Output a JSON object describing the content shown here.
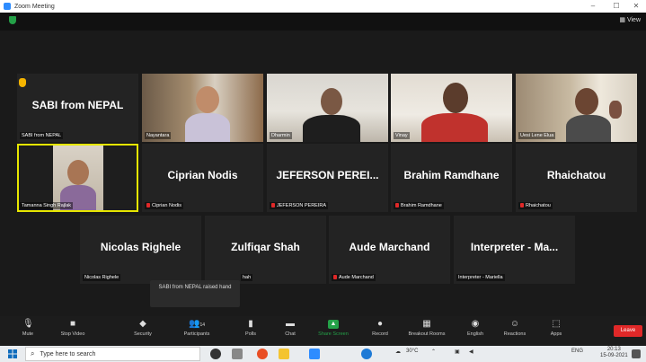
{
  "window": {
    "title": "Zoom Meeting",
    "controls": [
      "–",
      "☐",
      "✕"
    ]
  },
  "topbar": {
    "view_label": "View"
  },
  "tiles": [
    {
      "big_name": "SABI from NEPAL",
      "label": "SABI from NEPAL",
      "video": false,
      "muted": false,
      "hand_raised": true
    },
    {
      "big_name": "",
      "label": "Nayantara",
      "video": true,
      "muted": false
    },
    {
      "big_name": "",
      "label": "Dharmin",
      "video": true,
      "muted": false
    },
    {
      "big_name": "",
      "label": "Vinay",
      "video": true,
      "muted": false
    },
    {
      "big_name": "",
      "label": "Uesi Lene Elua",
      "video": true,
      "muted": false
    },
    {
      "big_name": "",
      "label": "Tamanna Singh Rajlak",
      "video": true,
      "muted": false,
      "active": true
    },
    {
      "big_name": "Ciprian Nodis",
      "label": "Ciprian Nodis",
      "video": false,
      "muted": true
    },
    {
      "big_name": "JEFERSON PEREI...",
      "label": "JEFERSON PEREIRA",
      "video": false,
      "muted": true
    },
    {
      "big_name": "Brahim Ramdhane",
      "label": "Brahim Ramdhane",
      "video": false,
      "muted": true
    },
    {
      "big_name": "Rhaichatou",
      "label": "Rhaichatou",
      "video": false,
      "muted": true
    },
    {
      "big_name": "Nicolas Righele",
      "label": "Nicolas Righele",
      "video": false,
      "muted": false
    },
    {
      "big_name": "Zulfiqar Shah",
      "label": "hah",
      "video": false,
      "muted": false
    },
    {
      "big_name": "Aude Marchand",
      "label": "Aude Marchand",
      "video": false,
      "muted": true
    },
    {
      "big_name": "Interpreter - Ma...",
      "label": "Interpreter - Mariella",
      "video": false,
      "muted": false
    }
  ],
  "tooltip": "SABI from NEPAL raised hand",
  "toolbar": {
    "unmute": "Mute",
    "stop_video": "Stop Video",
    "security": "Security",
    "participants": "Participants",
    "participants_count": "14",
    "polls": "Polls",
    "chat": "Chat",
    "share_screen": "Share Screen",
    "record": "Record",
    "breakout": "Breakout Rooms",
    "english": "English",
    "reactions": "Reactions",
    "apps": "Apps",
    "leave": "Leave"
  },
  "taskbar": {
    "search_placeholder": "Type here to search",
    "temperature": "30°C",
    "language": "ENG",
    "time": "20:13",
    "date": "15-09-2021"
  },
  "colors": {
    "accent_green": "#24a148",
    "leave_red": "#e02828",
    "hand_yellow": "#f5b400",
    "active_border": "#e6e600"
  }
}
